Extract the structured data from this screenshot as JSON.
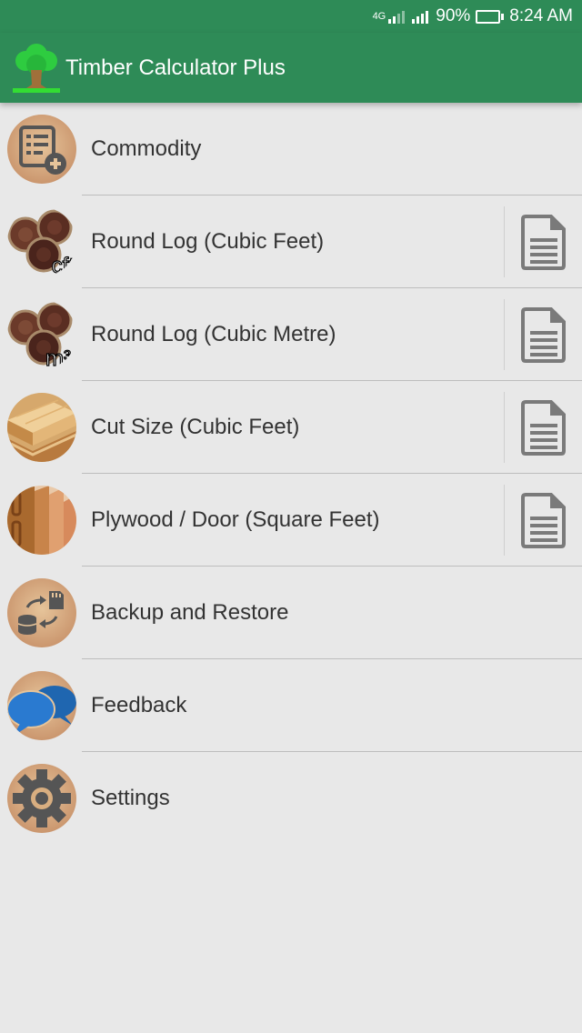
{
  "status_bar": {
    "network": "4G",
    "battery": "90%",
    "battery_level": 0.9,
    "time": "8:24 AM"
  },
  "app_bar": {
    "title": "Timber Calculator Plus",
    "logo_icon": "tree-icon",
    "color": "#2e8b57"
  },
  "menu": {
    "items": [
      {
        "label": "Commodity",
        "icon": "commodity-list-icon",
        "has_report": false
      },
      {
        "label": "Round Log (Cubic Feet)",
        "icon": "round-log-cft-icon",
        "icon_text": "cft",
        "has_report": true
      },
      {
        "label": "Round Log (Cubic Metre)",
        "icon": "round-log-m3-icon",
        "icon_text": "m³",
        "has_report": true
      },
      {
        "label": "Cut Size (Cubic Feet)",
        "icon": "cut-size-wood-icon",
        "has_report": true
      },
      {
        "label": "Plywood / Door (Square Feet)",
        "icon": "plywood-door-icon",
        "has_report": true
      },
      {
        "label": "Backup and Restore",
        "icon": "backup-restore-icon",
        "has_report": false
      },
      {
        "label": "Feedback",
        "icon": "feedback-chat-icon",
        "has_report": false
      },
      {
        "label": "Settings",
        "icon": "settings-gear-icon",
        "has_report": false
      }
    ],
    "report_icon": "document-icon"
  }
}
